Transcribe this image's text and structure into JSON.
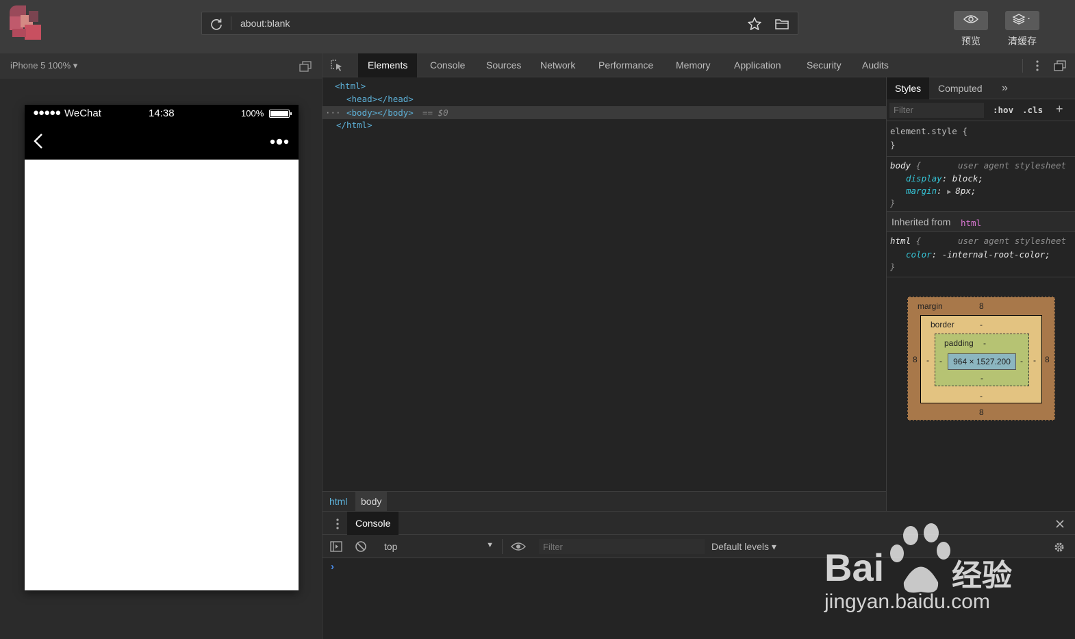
{
  "toolbar": {
    "url": "about:blank",
    "preview_label": "预览",
    "clear_cache_label": "清缓存"
  },
  "simulator": {
    "device": "iPhone 5 100% ▾",
    "status": {
      "signal": "●●●●●",
      "carrier": "WeChat",
      "time": "14:38",
      "battery": "100%"
    }
  },
  "devtools": {
    "tabs": [
      "Elements",
      "Console",
      "Sources",
      "Network",
      "Performance",
      "Memory",
      "Application",
      "Security",
      "Audits"
    ],
    "active_tab": "Elements",
    "dom": {
      "html_open": "<html>",
      "head": "<head></head>",
      "body_prefix": "···",
      "body": "<body></body>",
      "body_suffix": "== $0",
      "html_close": "</html>"
    },
    "breadcrumbs": [
      "html",
      "body"
    ],
    "styles": {
      "tabs": [
        "Styles",
        "Computed"
      ],
      "more": "»",
      "filter_placeholder": "Filter",
      "hov": ":hov",
      "cls": ".cls",
      "add": "+",
      "element_style_open": "element.style {",
      "brace_close": "}",
      "body_selector": "body",
      "brace_open": "{",
      "ua_label": "user agent stylesheet",
      "body_props": [
        {
          "name": "display",
          "value": "block;"
        },
        {
          "name": "margin",
          "value": "8px;"
        }
      ],
      "inherited_label": "Inherited from",
      "inherited_from": "html",
      "html_selector": "html",
      "html_props": [
        {
          "name": "color",
          "value": "-internal-root-color;"
        }
      ]
    },
    "box_model": {
      "margin_label": "margin",
      "margin_top": "8",
      "margin_bottom": "8",
      "margin_left": "8",
      "margin_right": "8",
      "border_label": "border",
      "border_top": "-",
      "border_bottom": "-",
      "border_left": "-",
      "border_right": "-",
      "padding_label": "padding",
      "padding_top": "-",
      "padding_bottom": "-",
      "padding_left": "-",
      "padding_right": "-",
      "content": "964 × 1527.200"
    },
    "drawer": {
      "tab": "Console",
      "context": "top",
      "filter_placeholder": "Filter",
      "levels": "Default levels ▾",
      "prompt": "›"
    }
  },
  "watermark": {
    "brand_left": "Bai",
    "brand_right": "经验",
    "url": "jingyan.baidu.com"
  },
  "colors": {
    "toolbar_bg": "#3c3c3c",
    "devtools_bg": "#242424",
    "tag_color": "#5db0d7",
    "prop_color": "#35c2d4",
    "active_tab_bg": "#1a1a1a"
  }
}
